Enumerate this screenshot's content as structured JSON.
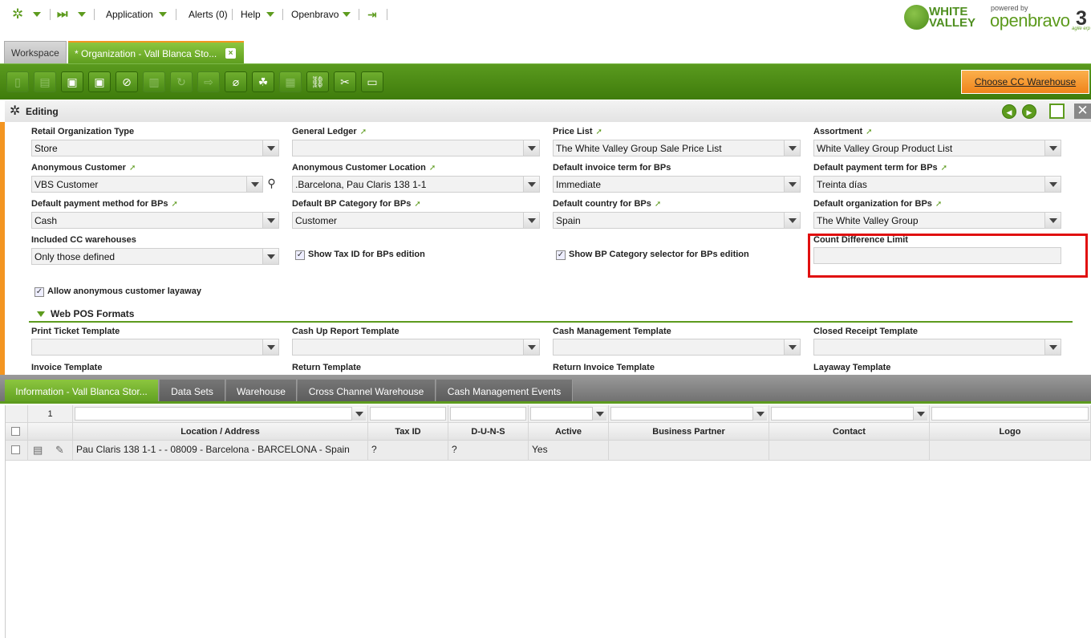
{
  "menu": {
    "application": "Application",
    "alerts": "Alerts (0)",
    "help": "Help",
    "openbravo": "Openbravo"
  },
  "logos": {
    "white_valley_line1": "WHITE",
    "white_valley_line2": "VALLEY",
    "powered_by": "powered by",
    "openbravo": "openbravo",
    "version": "3",
    "agile_erp": "agile erp"
  },
  "tabs": {
    "workspace": "Workspace",
    "current": "* Organization - Vall Blanca Sto...",
    "close": "×"
  },
  "toolbar": {
    "choose_cc_warehouse": "Choose CC Warehouse"
  },
  "editing": {
    "status": "Editing"
  },
  "form": {
    "retail_org_type": {
      "label": "Retail Organization Type",
      "value": "Store"
    },
    "general_ledger": {
      "label": "General Ledger",
      "value": ""
    },
    "price_list": {
      "label": "Price List",
      "value": "The White Valley Group Sale Price List"
    },
    "assortment": {
      "label": "Assortment",
      "value": "White Valley Group Product List"
    },
    "anon_customer": {
      "label": "Anonymous Customer",
      "value": "VBS Customer"
    },
    "anon_customer_location": {
      "label": "Anonymous Customer Location",
      "value": ".Barcelona, Pau Claris 138 1-1"
    },
    "default_invoice_term": {
      "label": "Default invoice term for BPs",
      "value": "Immediate"
    },
    "default_payment_term": {
      "label": "Default payment term for BPs",
      "value": "Treinta días"
    },
    "default_payment_method": {
      "label": "Default payment method for BPs",
      "value": "Cash"
    },
    "default_bp_category": {
      "label": "Default BP Category for BPs",
      "value": "Customer"
    },
    "default_country": {
      "label": "Default country for BPs",
      "value": "Spain"
    },
    "default_organization": {
      "label": "Default organization for BPs",
      "value": "The White Valley Group"
    },
    "included_cc_warehouses": {
      "label": "Included CC warehouses",
      "value": "Only those defined"
    },
    "show_tax_id": {
      "label": "Show Tax ID for BPs edition",
      "checked": true
    },
    "show_bp_category_selector": {
      "label": "Show BP Category selector for BPs edition",
      "checked": true
    },
    "count_difference_limit": {
      "label": "Count Difference Limit",
      "value": ""
    },
    "allow_anon_layaway": {
      "label": "Allow anonymous customer layaway",
      "checked": true
    },
    "section_webpos": "Web POS Formats",
    "print_ticket_template": {
      "label": "Print Ticket Template",
      "value": ""
    },
    "cash_up_report_template": {
      "label": "Cash Up Report Template",
      "value": ""
    },
    "cash_management_template": {
      "label": "Cash Management Template",
      "value": ""
    },
    "closed_receipt_template": {
      "label": "Closed Receipt Template",
      "value": ""
    },
    "invoice_template": {
      "label": "Invoice Template"
    },
    "return_template": {
      "label": "Return Template"
    },
    "return_invoice_template": {
      "label": "Return Invoice Template"
    },
    "layaway_template": {
      "label": "Layaway Template"
    },
    "check_mark": "✓"
  },
  "child_tabs": [
    "Information - Vall Blanca Stor...",
    "Data Sets",
    "Warehouse",
    "Cross Channel Warehouse",
    "Cash Management Events"
  ],
  "grid": {
    "filter_count": "1",
    "columns": [
      "Location / Address",
      "Tax ID",
      "D-U-N-S",
      "Active",
      "Business Partner",
      "Contact",
      "Logo"
    ],
    "rows": [
      {
        "location": "Pau Claris 138 1-1 -  - 08009 - Barcelona - BARCELONA   - Spain",
        "tax_id": "?",
        "duns": "?",
        "active": "Yes",
        "business_partner": "",
        "contact": "",
        "logo": ""
      }
    ]
  }
}
